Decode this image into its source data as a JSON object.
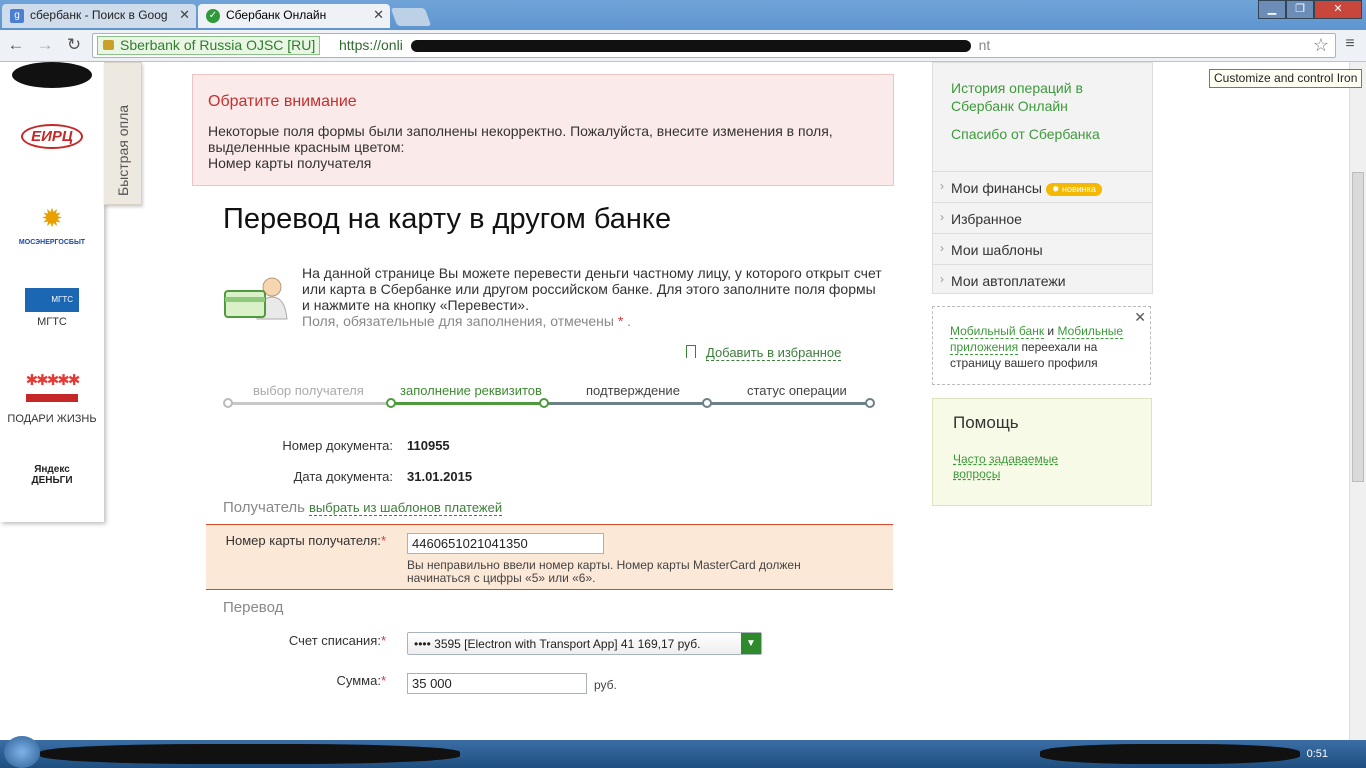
{
  "browser": {
    "tabs": [
      {
        "label": "сбербанк - Поиск в Goog",
        "icon": "google-icon"
      },
      {
        "label": "Сбербанк Онлайн",
        "icon": "sberbank-icon"
      }
    ],
    "security_label": "Sberbank of Russia OJSC [RU]",
    "url_prefix": "https://onli",
    "url_tail": "nt",
    "tooltip": "Customize and control Iron"
  },
  "left_panel": {
    "fast_pay_label": "Быстрая опла",
    "logos": [
      {
        "name": "eirc-logo",
        "text": "ЕИРЦ"
      },
      {
        "name": "mosenergosbyt-logo",
        "text": "МОСЭНЕРГОСБЫТ"
      },
      {
        "name": "mgts-logo",
        "text": "МГТС",
        "caption": "МГТС"
      },
      {
        "name": "podari-zhizn-logo",
        "caption": "ПОДАРИ ЖИЗНЬ"
      },
      {
        "name": "yandex-money-logo",
        "text": "Яндекс ДЕНЬГИ"
      }
    ]
  },
  "alert": {
    "title": "Обратите внимание",
    "line1": "Некоторые поля формы были заполнены некорректно. Пожалуйста, внесите изменения в поля, выделенные красным цветом:",
    "line2": "Номер карты получателя"
  },
  "page": {
    "title": "Перевод на карту в другом банке",
    "intro": "На данной странице Вы можете перевести деньги частному лицу, у которого открыт счет или карта в Сбербанке или другом российском банке. Для этого заполните поля формы и нажмите на кнопку «Перевести».",
    "required_note": "Поля, обязательные для заполнения, отмечены",
    "required_mark": "*",
    "required_end": ".",
    "add_favorite": "Добавить в избранное"
  },
  "steps": [
    {
      "label": "выбор получателя"
    },
    {
      "label": "заполнение реквизитов"
    },
    {
      "label": "подтверждение"
    },
    {
      "label": "статус операции"
    }
  ],
  "form": {
    "doc_number_label": "Номер документа:",
    "doc_number": "110955",
    "doc_date_label": "Дата документа:",
    "doc_date": "31.01.2015",
    "recipient_section": "Получатель",
    "choose_template": "выбрать из шаблонов платежей",
    "card_label": "Номер карты получателя:",
    "card_value": "4460651021041350",
    "card_error": "Вы неправильно ввели номер карты. Номер карты MasterCard должен начинаться с цифры «5» или «6».",
    "transfer_section": "Перевод",
    "account_label": "Счет списания:",
    "account_value": "•••• 3595  [Electron with Transport App] 41 169,17  руб.",
    "amount_label": "Сумма:",
    "amount_value": "35 000",
    "currency": "руб.",
    "required_mark": "*"
  },
  "sidebar": {
    "links": [
      "История операций в Сбербанк Онлайн",
      "Спасибо от Сбербанка"
    ],
    "nav": [
      {
        "label": "Мои финансы",
        "badge": "новинка"
      },
      {
        "label": "Избранное"
      },
      {
        "label": "Мои шаблоны"
      },
      {
        "label": "Мои автоплатежи"
      }
    ],
    "mobile_notice": {
      "link1": "Мобильный банк",
      "and": "и",
      "link2": "Мобильные приложения",
      "rest": "переехали на страницу вашего профиля"
    },
    "help": {
      "title": "Помощь",
      "faq": "Часто задаваемые вопросы"
    }
  },
  "taskbar": {
    "clock": "0:51"
  },
  "colors": {
    "accent_green": "#3d9a3b",
    "error_red": "#c43030",
    "alert_bg": "#fbeaea",
    "error_field_bg": "#fbe8d7",
    "help_bg": "#f7fae6"
  }
}
